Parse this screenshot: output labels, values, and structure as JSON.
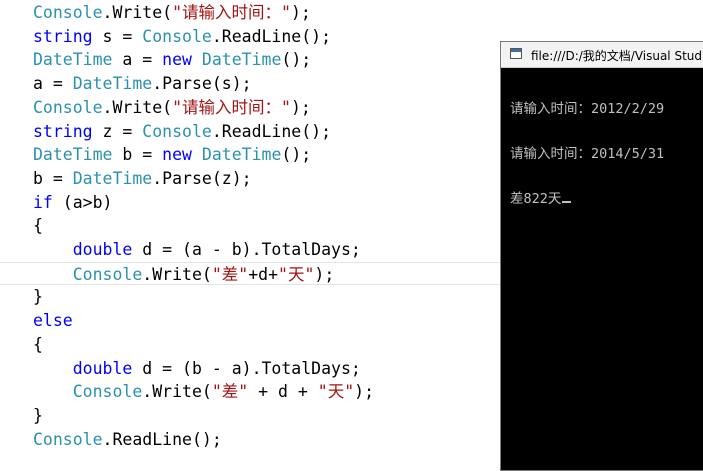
{
  "editor": {
    "line1": {
      "a": "Console",
      "b": ".Write(",
      "c": "\"请输入时间：\"",
      "d": ");"
    },
    "line2": {
      "a": "string",
      "b": " s = ",
      "c": "Console",
      "d": ".ReadLine();"
    },
    "line3": {
      "a": "DateTime",
      "b": " a = ",
      "c": "new",
      "d": " ",
      "e": "DateTime",
      "f": "();"
    },
    "line4": {
      "a": "a = ",
      "b": "DateTime",
      "c": ".Parse(s);"
    },
    "line5": {
      "a": "Console",
      "b": ".Write(",
      "c": "\"请输入时间：\"",
      "d": ");"
    },
    "line6": {
      "a": "string",
      "b": " z = ",
      "c": "Console",
      "d": ".ReadLine();"
    },
    "line7": {
      "a": "DateTime",
      "b": " b = ",
      "c": "new",
      "d": " ",
      "e": "DateTime",
      "f": "();"
    },
    "line8": {
      "a": "b = ",
      "b": "DateTime",
      "c": ".Parse(z);"
    },
    "line9": {
      "a": "if",
      "b": " (a>b)"
    },
    "line10": {
      "a": "{"
    },
    "line11": {
      "a": "    ",
      "b": "double",
      "c": " d = (a - b).TotalDays;"
    },
    "line12": {
      "a": "    ",
      "b": "Console",
      "c": ".Write(",
      "d": "\"差\"",
      "e": "+d+",
      "f": "\"天\"",
      "g": ");"
    },
    "line13": {
      "a": "}"
    },
    "line14": {
      "a": "else"
    },
    "line15": {
      "a": "{"
    },
    "line16": {
      "a": "    ",
      "b": "double",
      "c": " d = (b - a).TotalDays;"
    },
    "line17": {
      "a": "    ",
      "b": "Console",
      "c": ".Write(",
      "d": "\"差\"",
      "e": " + d + ",
      "f": "\"天\"",
      "g": ");"
    },
    "line18": {
      "a": "}"
    },
    "line19": {
      "a": "Console",
      "b": ".ReadLine();"
    }
  },
  "console": {
    "title": "file:///D:/我的文档/Visual Stud",
    "lines": [
      "请输入时间：2012/2/29",
      "请输入时间：2014/5/31",
      "差822天"
    ]
  },
  "colors": {
    "keyword": "#0000ff",
    "type": "#2b91af",
    "string": "#a31515"
  }
}
